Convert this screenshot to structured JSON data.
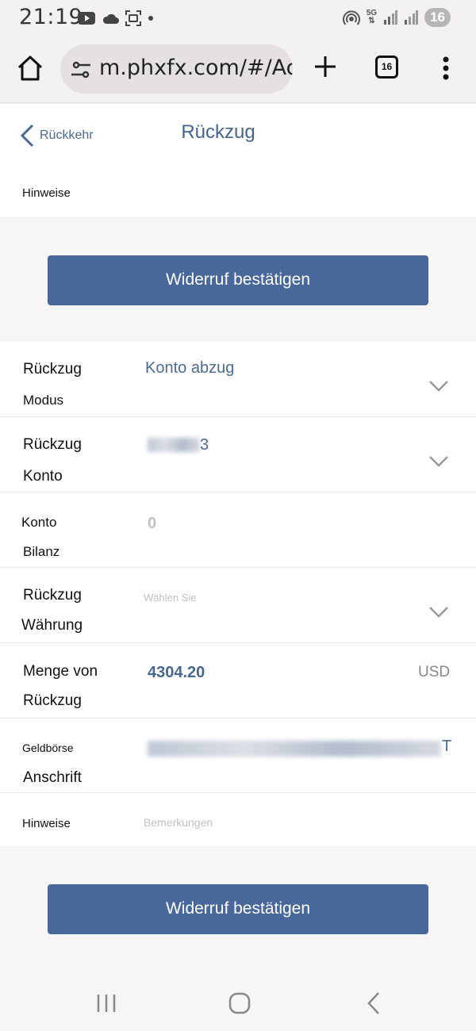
{
  "status_bar": {
    "time": "21:19",
    "network": "5G",
    "battery": "16"
  },
  "browser": {
    "url": "m.phxfx.com/#/Ac",
    "tab_count": "16"
  },
  "header": {
    "back_label": "Rückkehr",
    "title": "Rückzug",
    "hint_label": "Hinweise"
  },
  "actions": {
    "confirm_label": "Widerruf bestätigen"
  },
  "form": {
    "mode": {
      "label_line1": "Rückzug",
      "label_line2": "Modus",
      "value": "Konto abzug"
    },
    "account": {
      "label_line1": "Rückzug",
      "label_line2": "Konto",
      "value_end": "3"
    },
    "balance": {
      "label_line1": "Konto",
      "label_line2": "Bilanz",
      "value": "0"
    },
    "currency": {
      "label_line1": "Rückzug",
      "label_line2": "Währung",
      "placeholder": "Wählen Sie"
    },
    "amount": {
      "label_line1": "Menge von",
      "label_line2": "Rückzug",
      "value": "4304.20",
      "unit": "USD"
    },
    "wallet": {
      "label_line1": "Geldbörse",
      "label_line2": "Anschrift",
      "value_end": "T"
    },
    "notes": {
      "label": "Hinweise",
      "placeholder": "Bemerkungen"
    }
  },
  "colors": {
    "accent": "#48679b",
    "link": "#4a6991"
  }
}
